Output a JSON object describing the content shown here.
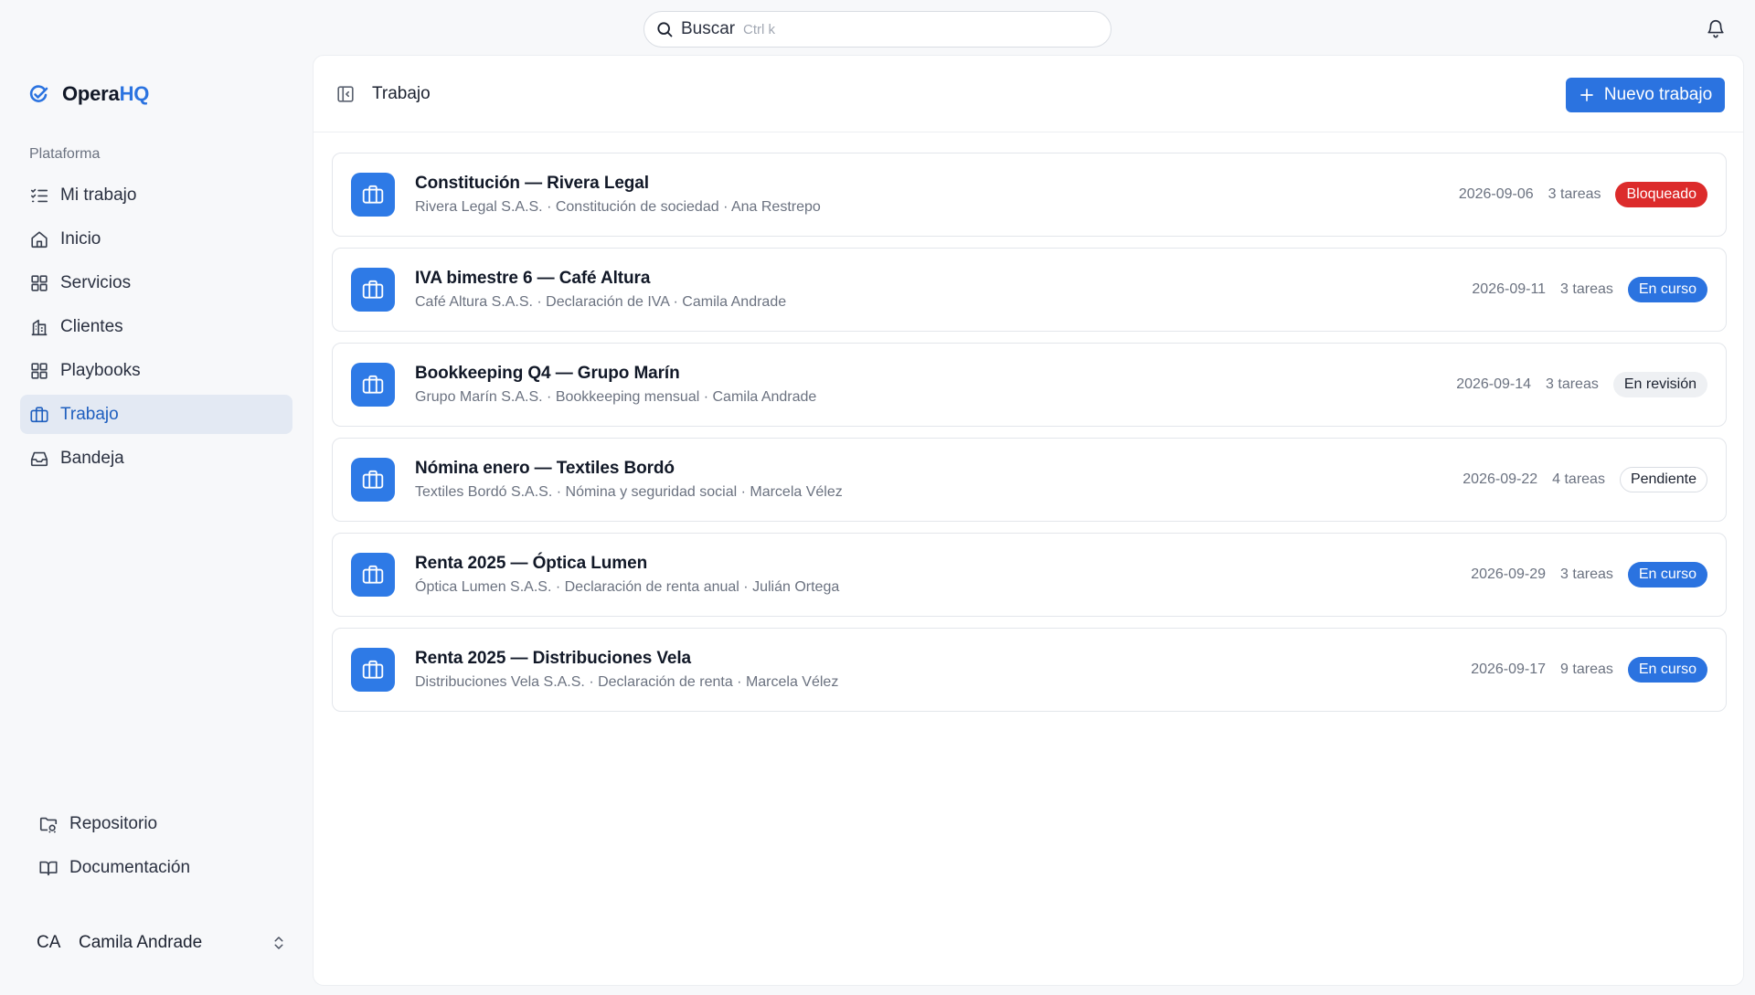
{
  "search": {
    "placeholder": "Buscar",
    "shortcut": "Ctrl k"
  },
  "brand": {
    "name_main": "Opera",
    "name_accent": "HQ"
  },
  "sidebar": {
    "section_label": "Plataforma",
    "items": [
      {
        "label": "Mi trabajo",
        "icon": "checklist-icon"
      },
      {
        "label": "Inicio",
        "icon": "home-icon"
      },
      {
        "label": "Servicios",
        "icon": "grid-icon"
      },
      {
        "label": "Clientes",
        "icon": "building-icon"
      },
      {
        "label": "Playbooks",
        "icon": "grid-icon"
      },
      {
        "label": "Trabajo",
        "icon": "briefcase-icon",
        "active": true
      },
      {
        "label": "Bandeja",
        "icon": "inbox-icon"
      }
    ],
    "bottom_items": [
      {
        "label": "Repositorio",
        "icon": "folder-icon"
      },
      {
        "label": "Documentación",
        "icon": "book-icon"
      }
    ],
    "user": {
      "initials": "CA",
      "name": "Camila Andrade"
    }
  },
  "main": {
    "title": "Trabajo",
    "new_button": "Nuevo trabajo",
    "rows": [
      {
        "title": "Constitución — Rivera Legal",
        "subtitle": "Rivera Legal S.A.S. · Constitución de sociedad · Ana Restrepo",
        "date": "2026-09-06",
        "tasks": "3 tareas",
        "status": "Bloqueado",
        "status_kind": "blocked"
      },
      {
        "title": "IVA bimestre 6 — Café Altura",
        "subtitle": "Café Altura S.A.S. · Declaración de IVA · Camila Andrade",
        "date": "2026-09-11",
        "tasks": "3 tareas",
        "status": "En curso",
        "status_kind": "progress"
      },
      {
        "title": "Bookkeeping Q4 — Grupo Marín",
        "subtitle": "Grupo Marín S.A.S. · Bookkeeping mensual · Camila Andrade",
        "date": "2026-09-14",
        "tasks": "3 tareas",
        "status": "En revisión",
        "status_kind": "review"
      },
      {
        "title": "Nómina enero — Textiles Bordó",
        "subtitle": "Textiles Bordó S.A.S. · Nómina y seguridad social · Marcela Vélez",
        "date": "2026-09-22",
        "tasks": "4 tareas",
        "status": "Pendiente",
        "status_kind": "pending"
      },
      {
        "title": "Renta 2025 — Óptica Lumen",
        "subtitle": "Óptica Lumen S.A.S. · Declaración de renta anual · Julián Ortega",
        "date": "2026-09-29",
        "tasks": "3 tareas",
        "status": "En curso",
        "status_kind": "progress"
      },
      {
        "title": "Renta 2025 — Distribuciones Vela",
        "subtitle": "Distribuciones Vela S.A.S. · Declaración de renta · Marcela Vélez",
        "date": "2026-09-17",
        "tasks": "9 tareas",
        "status": "En curso",
        "status_kind": "progress"
      }
    ]
  },
  "colors": {
    "accent": "#2b73e0",
    "blocked": "#dc2b2b",
    "active_nav_bg": "#e3e9f3",
    "background": "#f7f8fa"
  }
}
